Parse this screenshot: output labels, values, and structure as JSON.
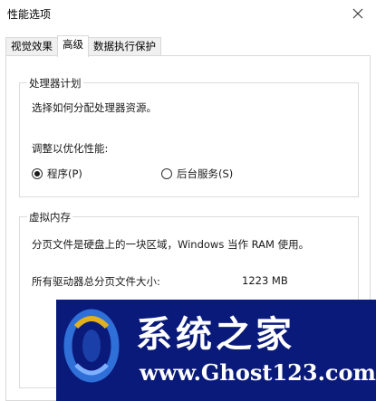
{
  "window": {
    "title": "性能选项"
  },
  "tabs": [
    {
      "label": "视觉效果",
      "active": false
    },
    {
      "label": "高级",
      "active": true
    },
    {
      "label": "数据执行保护",
      "active": false
    }
  ],
  "processor": {
    "legend": "处理器计划",
    "description": "选择如何分配处理器资源。",
    "adjust_label": "调整以优化性能:",
    "options": [
      {
        "label": "程序(P)",
        "selected": true
      },
      {
        "label": "后台服务(S)",
        "selected": false
      }
    ]
  },
  "virtual_memory": {
    "legend": "虚拟内存",
    "description": "分页文件是硬盘上的一块区域，Windows 当作 RAM 使用。",
    "total_label": "所有驱动器总分页文件大小:",
    "total_value": "1223 MB"
  },
  "watermark": {
    "title": "系统之家",
    "url": "www.Ghost123.com",
    "colors": {
      "background": "#0a1a7a",
      "logo_blue": "#2e6fd8",
      "logo_gold": "#e0b020"
    }
  }
}
